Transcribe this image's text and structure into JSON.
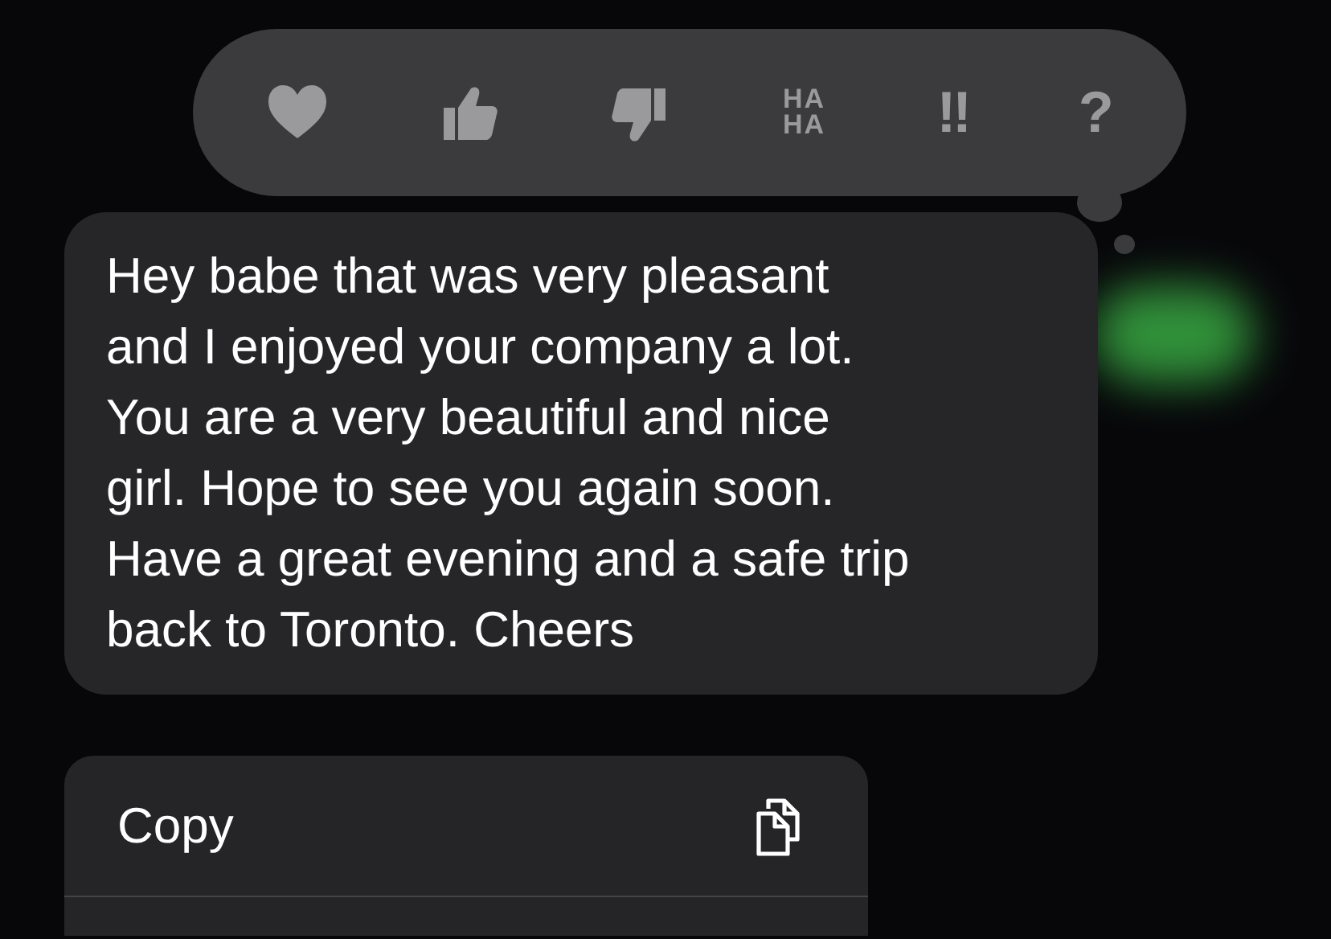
{
  "tapbacks": [
    {
      "kind": "heart"
    },
    {
      "kind": "thumbs-up"
    },
    {
      "kind": "thumbs-down"
    },
    {
      "kind": "text",
      "label": "HA HA"
    },
    {
      "kind": "text",
      "label": "‼"
    },
    {
      "kind": "text",
      "label": "?"
    }
  ],
  "message": {
    "text": "Hey babe that was very pleasant\nand I enjoyed your company a lot.\nYou are a very beautiful and nice\ngirl. Hope to see you again soon.\nHave a great evening and a safe trip\nback to Toronto. Cheers"
  },
  "menu": [
    {
      "label": "Copy",
      "kind": "copy"
    }
  ]
}
